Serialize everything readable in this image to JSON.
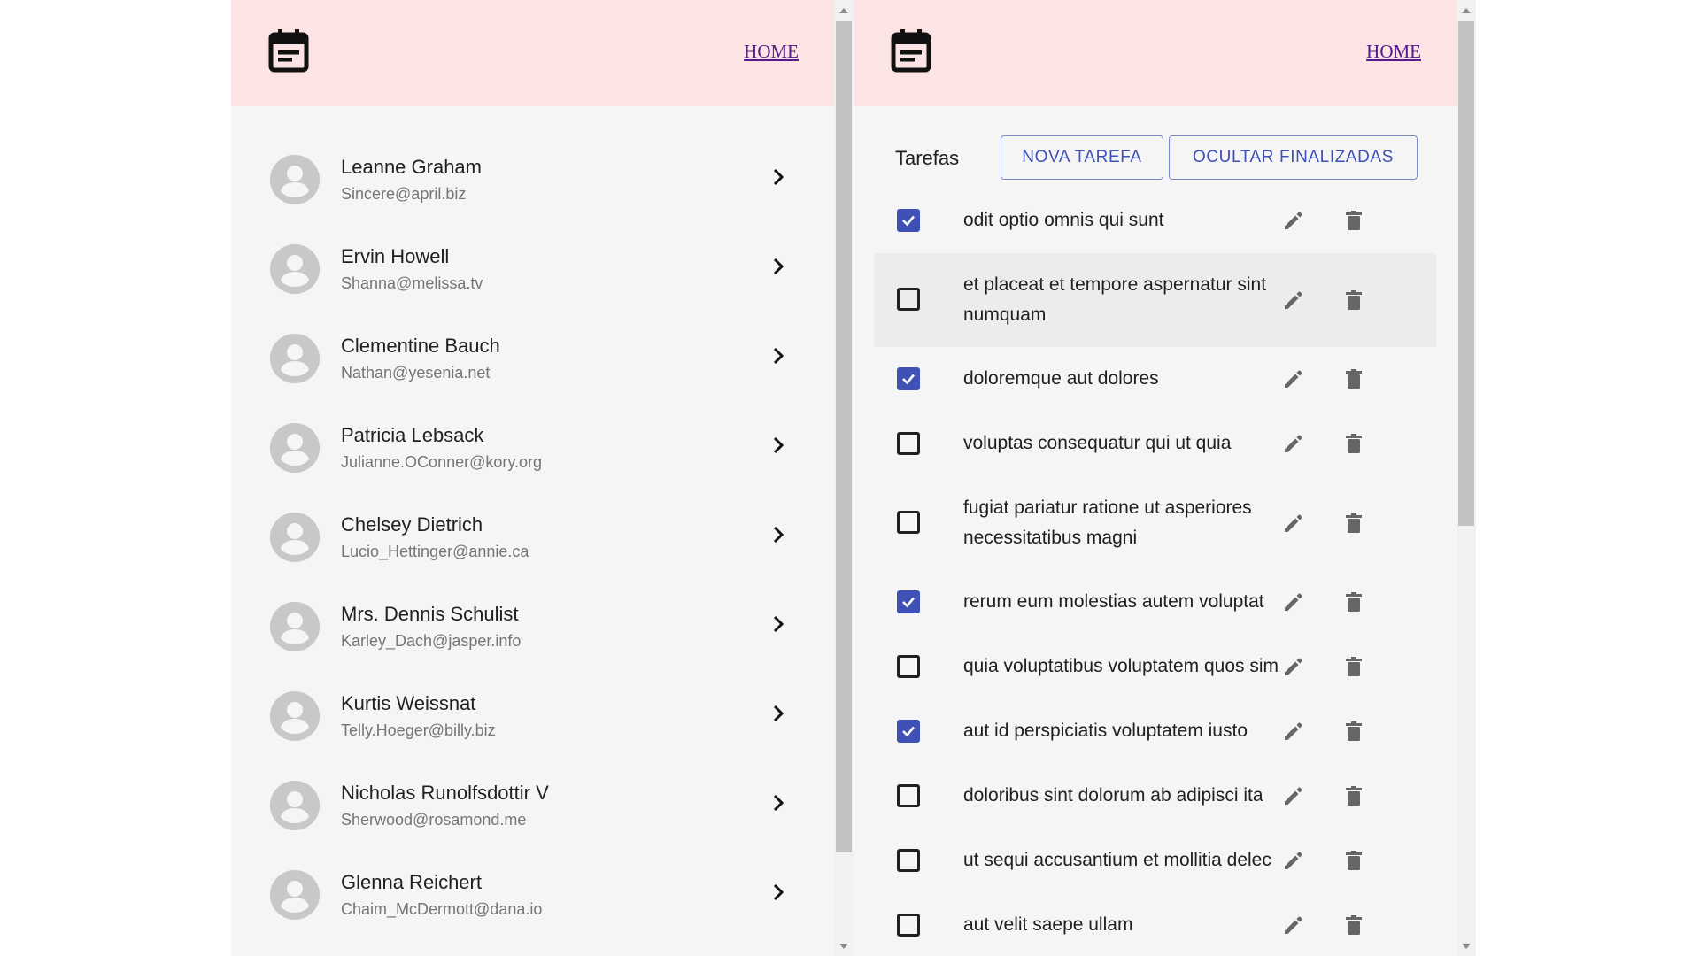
{
  "users_pane": {
    "header": {
      "home_label": "HOME"
    },
    "users": [
      {
        "name": "Leanne Graham",
        "email": "Sincere@april.biz"
      },
      {
        "name": "Ervin Howell",
        "email": "Shanna@melissa.tv"
      },
      {
        "name": "Clementine Bauch",
        "email": "Nathan@yesenia.net"
      },
      {
        "name": "Patricia Lebsack",
        "email": "Julianne.OConner@kory.org"
      },
      {
        "name": "Chelsey Dietrich",
        "email": "Lucio_Hettinger@annie.ca"
      },
      {
        "name": "Mrs. Dennis Schulist",
        "email": "Karley_Dach@jasper.info"
      },
      {
        "name": "Kurtis Weissnat",
        "email": "Telly.Hoeger@billy.biz"
      },
      {
        "name": "Nicholas Runolfsdottir V",
        "email": "Sherwood@rosamond.me"
      },
      {
        "name": "Glenna Reichert",
        "email": "Chaim_McDermott@dana.io"
      }
    ]
  },
  "tasks_pane": {
    "header": {
      "home_label": "HOME"
    },
    "toolbar": {
      "title": "Tarefas",
      "new_task_label": "NOVA TAREFA",
      "hide_done_label": "OCULTAR FINALIZADAS"
    },
    "tasks": [
      {
        "title": "odit optio omnis qui sunt",
        "completed": true
      },
      {
        "title": "et placeat et tempore aspernatur sint numquam",
        "completed": false,
        "hovered": true
      },
      {
        "title": "doloremque aut dolores",
        "completed": true
      },
      {
        "title": "voluptas consequatur qui ut quia",
        "completed": false
      },
      {
        "title": "fugiat pariatur ratione ut asperiores necessitatibus magni",
        "completed": false
      },
      {
        "title": "rerum eum molestias autem voluptat",
        "completed": true
      },
      {
        "title": "quia voluptatibus voluptatem quos sim",
        "completed": false
      },
      {
        "title": "aut id perspiciatis voluptatem iusto",
        "completed": true
      },
      {
        "title": "doloribus sint dolorum ab adipisci ita",
        "completed": false
      },
      {
        "title": "ut sequi accusantium et mollitia delec",
        "completed": false
      },
      {
        "title": "aut velit saepe ullam",
        "completed": false
      }
    ]
  },
  "icons": {
    "logo": "calendar-icon",
    "avatar": "account-circle-icon",
    "row_action": "chevron-right-icon",
    "edit": "pencil-icon",
    "delete": "trash-icon",
    "checked": "check-icon"
  },
  "colors": {
    "header_bg": "#fce4e4",
    "panel_bg": "#f5f5f5",
    "accent": "#3f51b5",
    "link": "#551a8b"
  }
}
